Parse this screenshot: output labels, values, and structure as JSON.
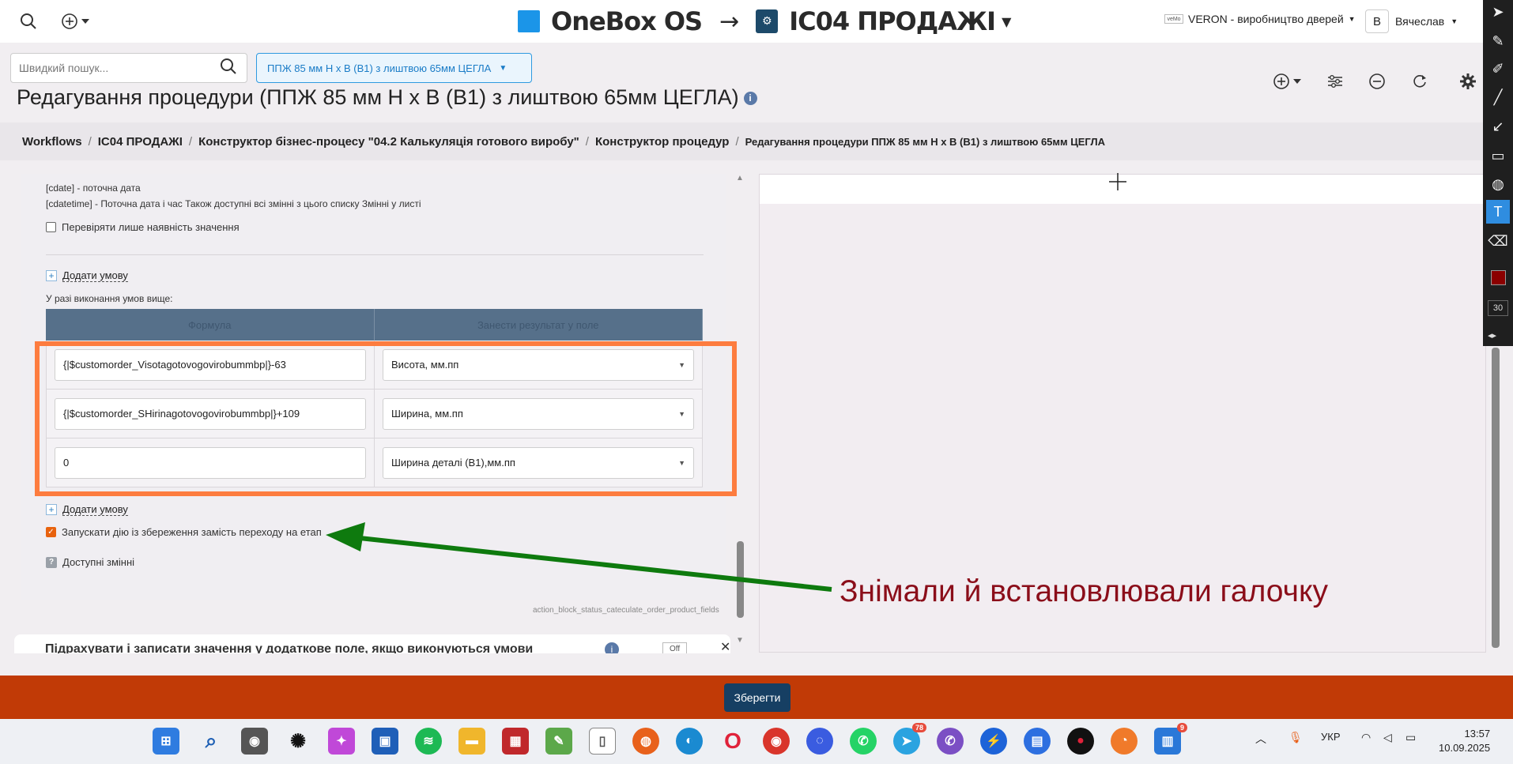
{
  "topbar": {
    "brand": "OneBox OS",
    "arrow": "→",
    "workspace": "ІС04 ПРОДАЖІ",
    "company": "VERON - виробництво дверей",
    "company_mini": "veMo",
    "user_initial": "В",
    "user_name": "Вячеслав"
  },
  "search": {
    "placeholder": "Швидкий пошук..."
  },
  "procedure_button": "ППЖ 85 мм Н х В (В1) з лиштвою 65мм ЦЕГЛА",
  "page_title": "Редагування процедури (ППЖ 85 мм Н х В (В1) з лиштвою 65мм ЦЕГЛА)",
  "breadcrumb": [
    "Workflows",
    "ІС04 ПРОДАЖІ",
    "Конструктор бізнес-процесу \"04.2 Калькуляція готового виробу\"",
    "Конструктор процедур",
    "Редагування процедури ППЖ 85 мм Н х В (В1) з лиштвою 65мм ЦЕГЛА"
  ],
  "panel": {
    "hint_cdate": "[cdate] - поточна дата",
    "hint_cdatetime": "[cdatetime] - Поточна дата і час Також доступні всі змінні з цього списку Змінні у листі",
    "check_presence": "Перевіряти лише наявність значення",
    "add_condition": "Додати умову",
    "if_conditions": "У разі виконання умов вище:",
    "col_formula": "Формула",
    "col_target": "Занести результат у поле",
    "rows": [
      {
        "formula": "{|$customorder_Visotagotovogovirobummbp|}-63",
        "target": "Висота, мм.пп"
      },
      {
        "formula": "{|$customorder_SHirinagotovogovirobummbp|}+109",
        "target": "Ширина, мм.пп"
      },
      {
        "formula": "0",
        "target": "Ширина деталі (В1),мм.пп"
      }
    ],
    "add_condition_2": "Додати умову",
    "run_action": "Запускати дію із збереження замість переходу на етап",
    "available_vars": "Доступні змінні",
    "action_id": "action_block_status_cateculate_order_product_fields",
    "next_section": "Підрахувати і записати значення у додаткове поле, якщо виконуються умови",
    "next_info": "i",
    "next_off": "Off"
  },
  "save_button": "Зберегти",
  "annotation": "Знімали й встановлювали галочку",
  "draw_size": "30",
  "colors": {
    "annotation": "#8b0e1a",
    "highlight": "#fd7c3f",
    "arrow": "#0e7a0e",
    "bottom_bar": "#c13a06"
  },
  "taskbar": {
    "badges": {
      "telegram": "78",
      "notes": "9"
    },
    "lang": "УКР",
    "time": "13:57",
    "date": "10.09.2025"
  }
}
